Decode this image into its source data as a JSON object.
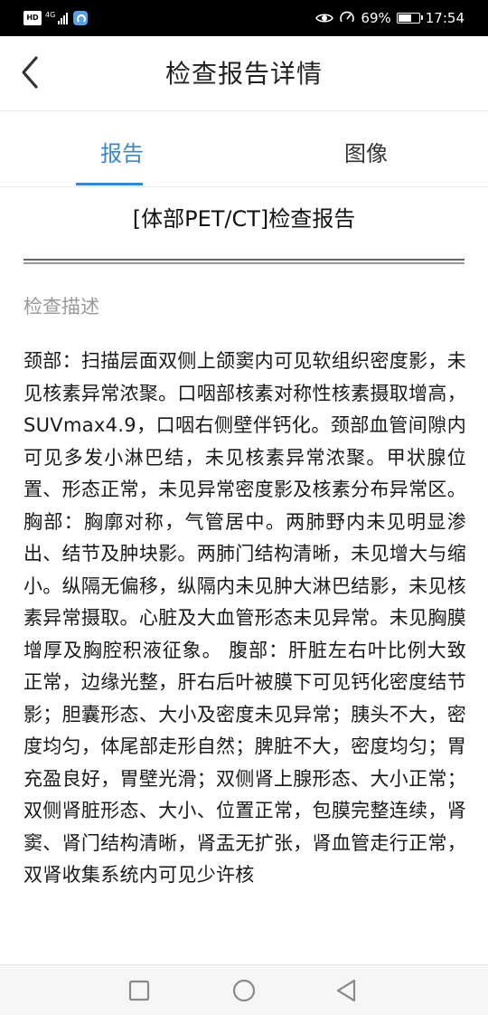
{
  "status_bar": {
    "hd_label": "HD",
    "network_label": "4G",
    "battery_text": "69%",
    "battery_level": 0.69,
    "time": "17:54"
  },
  "header": {
    "title": "检查报告详情",
    "back_icon": "chevron-left-icon"
  },
  "tabs": [
    {
      "label": "报告",
      "active": true
    },
    {
      "label": "图像",
      "active": false
    }
  ],
  "report": {
    "heading": "[体部PET/CT]检查报告",
    "section_title": "检查描述",
    "description": "颈部：扫描层面双侧上颌窦内可见软组织密度影，未见核素异常浓聚。口咽部核素对称性核素摄取增高，SUVmax4.9，口咽右侧壁伴钙化。颈部血管间隙内可见多发小淋巴结，未见核素异常浓聚。甲状腺位置、形态正常，未见异常密度影及核素分布异常区。 胸部：胸廓对称，气管居中。两肺野内未见明显渗出、结节及肿块影。两肺门结构清晰，未见增大与缩小。纵隔无偏移，纵隔内未见肿大淋巴结影，未见核素异常摄取。心脏及大血管形态未见异常。未见胸膜增厚及胸腔积液征象。 腹部：肝脏左右叶比例大致正常，边缘光整，肝右后叶被膜下可见钙化密度结节影；胆囊形态、大小及密度未见异常；胰头不大，密度均匀，体尾部走形自然；脾脏不大，密度均匀；胃充盈良好，胃壁光滑；双侧肾上腺形态、大小正常；双侧肾脏形态、大小、位置正常，包膜完整连续，肾窦、肾门结构清晰，肾盂无扩张，肾血管走行正常，双肾收集系统内可见少许核"
  },
  "nav_bar": {
    "buttons": [
      "recent-apps-icon",
      "home-icon",
      "back-triangle-icon"
    ]
  },
  "colors": {
    "accent": "#3a86c8",
    "text": "#1a1a1a",
    "muted": "#999999",
    "status_bar": "#000000"
  }
}
